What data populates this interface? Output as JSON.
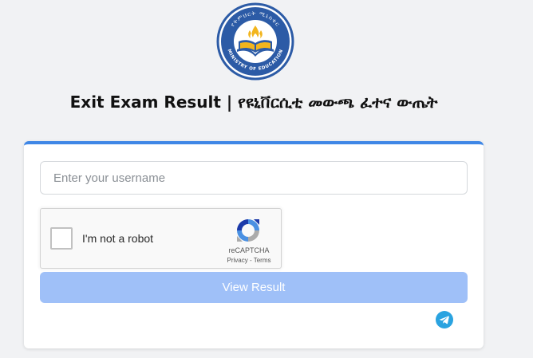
{
  "header": {
    "logo_text_top": "የትምህርት ሚኒስቴር",
    "logo_text_bottom": "MINISTRY OF EDUCATION",
    "title": "Exit Exam Result | የዩኒቨርሲቲ መውጫ ፈተና ውጤት"
  },
  "form": {
    "username_placeholder": "Enter your username",
    "username_value": "",
    "submit_label": "View Result"
  },
  "recaptcha": {
    "label": "I'm not a robot",
    "brand": "reCAPTCHA",
    "privacy": "Privacy",
    "separator": " - ",
    "terms": "Terms"
  },
  "icons": {
    "logo": "ministry-emblem-icon",
    "recaptcha": "recaptcha-arrows-icon",
    "social": "telegram-icon"
  },
  "colors": {
    "accent": "#3f87e6",
    "button": "#9fc0f8",
    "telegram": "#2aa3e0",
    "emblem_blue": "#2c5ba6",
    "emblem_yellow": "#f2b51d"
  }
}
